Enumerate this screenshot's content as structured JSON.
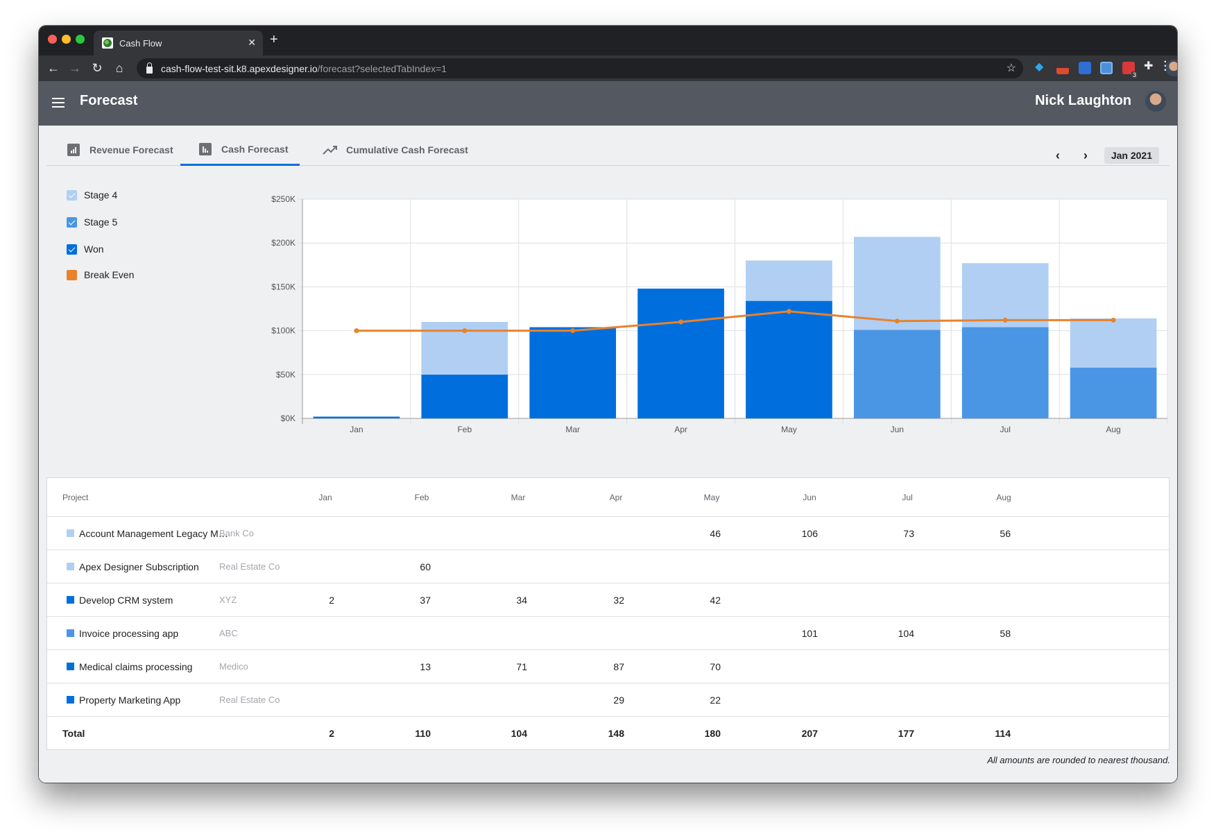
{
  "browser": {
    "tab_title": "Cash Flow",
    "url_host": "cash-flow-test-sit.k8.apexdesigner.io",
    "url_path": "/forecast?selectedTabIndex=1",
    "extension_badge": "3"
  },
  "header": {
    "title": "Forecast",
    "user_name": "Nick Laughton"
  },
  "tabs": [
    {
      "label": "Revenue Forecast",
      "icon": "bar-chart-icon",
      "active": false
    },
    {
      "label": "Cash Forecast",
      "icon": "bar-chart-icon",
      "active": true
    },
    {
      "label": "Cumulative Cash Forecast",
      "icon": "trending-up-icon",
      "active": false
    }
  ],
  "date_nav": {
    "current": "Jan 2021",
    "prev_icon": "chevron-left-icon",
    "next_icon": "chevron-right-icon"
  },
  "legend": [
    {
      "label": "Stage 4",
      "checked": true,
      "color": "#b0cff3"
    },
    {
      "label": "Stage 5",
      "checked": true,
      "color": "#4a96e4"
    },
    {
      "label": "Won",
      "checked": true,
      "color": "#006fdd"
    },
    {
      "label": "Break Even",
      "checked": false,
      "color": "#e8822c"
    }
  ],
  "chart_data": {
    "type": "bar",
    "stacked": true,
    "categories": [
      "Jan",
      "Feb",
      "Mar",
      "Apr",
      "May",
      "Jun",
      "Jul",
      "Aug"
    ],
    "series": [
      {
        "name": "Won",
        "color": "#006fdd",
        "values": [
          2,
          50,
          104,
          148,
          134,
          0,
          0,
          0
        ]
      },
      {
        "name": "Stage 5",
        "color": "#4a96e4",
        "values": [
          0,
          0,
          0,
          0,
          0,
          101,
          104,
          58
        ]
      },
      {
        "name": "Stage 4",
        "color": "#b0cff3",
        "values": [
          0,
          60,
          0,
          0,
          46,
          106,
          73,
          56
        ]
      }
    ],
    "line_series": {
      "name": "Break Even",
      "type": "line",
      "color": "#e8822c",
      "values": [
        100,
        100,
        100,
        110,
        122,
        111,
        112,
        112
      ]
    },
    "units": "thousands USD",
    "yticks": [
      "$0K",
      "$50K",
      "$100K",
      "$150K",
      "$200K",
      "$250K"
    ],
    "ylim": [
      0,
      250
    ],
    "ytick_step": 50,
    "grid": true,
    "legend_position": "left",
    "title": "",
    "xlabel": "",
    "ylabel": ""
  },
  "table": {
    "columns": [
      "Project",
      "Jan",
      "Feb",
      "Mar",
      "Apr",
      "May",
      "Jun",
      "Jul",
      "Aug"
    ],
    "rows": [
      {
        "name": "Account Management Legacy Mi…",
        "client": "Bank Co",
        "stage_color": "#b0cff3",
        "values": [
          "",
          "",
          "",
          "",
          "46",
          "106",
          "73",
          "56"
        ]
      },
      {
        "name": "Apex Designer Subscription",
        "client": "Real Estate Co",
        "stage_color": "#b0cff3",
        "values": [
          "",
          "60",
          "",
          "",
          "",
          "",
          "",
          ""
        ]
      },
      {
        "name": "Develop CRM system",
        "client": "XYZ",
        "stage_color": "#006fdd",
        "values": [
          "2",
          "37",
          "34",
          "32",
          "42",
          "",
          "",
          ""
        ]
      },
      {
        "name": "Invoice processing app",
        "client": "ABC",
        "stage_color": "#4a96e4",
        "values": [
          "",
          "",
          "",
          "",
          "",
          "101",
          "104",
          "58"
        ]
      },
      {
        "name": "Medical claims processing",
        "client": "Medico",
        "stage_color": "#006fdd",
        "values": [
          "",
          "13",
          "71",
          "87",
          "70",
          "",
          "",
          ""
        ]
      },
      {
        "name": "Property Marketing App",
        "client": "Real Estate Co",
        "stage_color": "#006fdd",
        "values": [
          "",
          "",
          "",
          "29",
          "22",
          "",
          "",
          ""
        ]
      }
    ],
    "total": {
      "label": "Total",
      "values": [
        "2",
        "110",
        "104",
        "148",
        "180",
        "207",
        "177",
        "114"
      ]
    }
  },
  "footnote": "All amounts are rounded to nearest thousand."
}
